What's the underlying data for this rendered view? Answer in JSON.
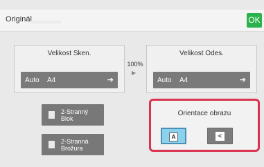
{
  "header": {
    "title": "Originál",
    "ok_label": "OK",
    "ok_color": "#2bb24c"
  },
  "scan_size": {
    "label": "Velikost Sken.",
    "value_mode": "Auto",
    "value_size": "A4",
    "arrow_icon": "arrow-right-icon"
  },
  "zoom": {
    "value": "100%"
  },
  "send_size": {
    "label": "Velikost Odes.",
    "value_mode": "Auto",
    "value_size": "A4",
    "arrow_icon": "arrow-right-icon"
  },
  "buttons": {
    "two_sided_block": {
      "line1": "2-Stranný",
      "line2": "Blok",
      "icon": "book-icon"
    },
    "two_sided_booklet": {
      "line1": "2-Stranná",
      "line2": "Brožura",
      "icon": "booklet-icon"
    }
  },
  "orientation": {
    "label": "Orientace obrazu",
    "options": [
      {
        "glyph": "A",
        "icon": "portrait-orientation-icon",
        "selected": true
      },
      {
        "glyph": "<",
        "icon": "landscape-orientation-icon",
        "selected": false
      }
    ],
    "highlight_color": "#d9334f"
  }
}
